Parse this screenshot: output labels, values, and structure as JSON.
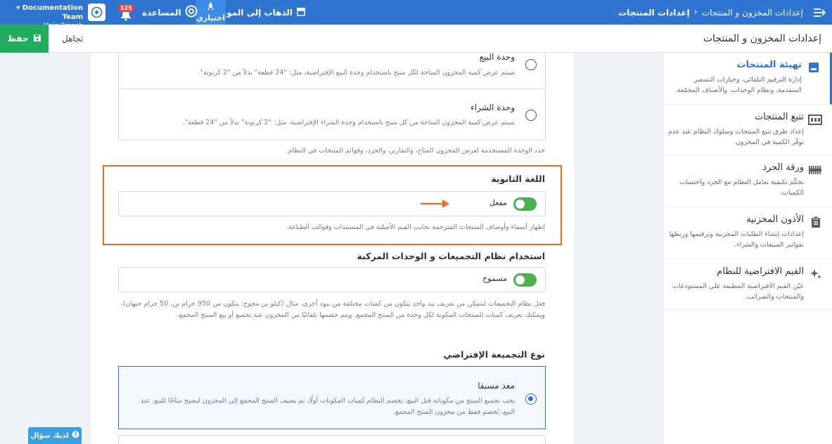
{
  "topbar": {
    "breadcrumbs": [
      "إعدادات المخزون و المنتجات",
      "إعدادات المنتجات"
    ],
    "visit_site": "الذهاب إلى الموقع",
    "beta": "اختياري",
    "help": "المساعدة",
    "notifications_count": "125",
    "org_name": "Documentation Team",
    "branch": "Main Branch"
  },
  "header": {
    "title": "إعدادات المخزون و المنتجات",
    "save": "حفظ",
    "ignore": "تجاهل"
  },
  "sidebar": {
    "items": [
      {
        "title": "تهيئة المنتجات",
        "desc": "إدارة الترقيم التلقائي، وخيارات التسعير المتقدمة، ونظام الوحدات، والأصناف المجمّعة."
      },
      {
        "title": "تتبع المنتجات",
        "desc": "إعداد طرق تتبع المنتجات وسلوك النظام عند عدم توفّر الكمية في المخزون."
      },
      {
        "title": "ورقة الجرد",
        "desc": "تحكّم بكيفية تعامل النظام مع الجرد واحتساب الكميات."
      },
      {
        "title": "الأذون المخزنية",
        "desc": "إعدادات إنشاء الطلبات المخزنية وترقيمها وربطها بفواتير المبيعات والشراء."
      },
      {
        "title": "القيم الافتراضية للنظام",
        "desc": "عيّن القيم الافتراضية المطبقة على المستودعات والمنتجات والضرائب."
      }
    ]
  },
  "main": {
    "unit_options": [
      {
        "title": "وحدة البيع",
        "desc": "سيتم عرض كمية المخزون المتاحة لكل منتج باستخدام وحدة البيع الإفتراضية، مثل: \"24 قطعة\" بدلاً من \"2 كرتونة\"."
      },
      {
        "title": "وحدة الشراء",
        "desc": "سيتم عرض كمية المخزون المتاحة من كل منتج باستخدام وحدة الشراء الإفتراضية، مثل: \"2 كرتونة\" بدلاً من \"24 قطعة\"."
      }
    ],
    "unit_help": "حدد الوحدة المستخدمة لعرض المخزون المتاح، والتقارير، والجرد، وقوائم المنتجات في النظام.",
    "secondary_language": {
      "title": "اللغة الثانوية",
      "toggle_label": "مفعل",
      "help": "إظهار أسماء وأوصاف المنتجات المترجمة بجانب القيم الأصلية في المستندات وقوالب الطباعة."
    },
    "bundles": {
      "title": "استخدام نظام التجميعات و الوحدات المركبة",
      "toggle_label": "مسموح",
      "help": "فعل نظام التجميعات لتتمكن من تعريف بند واحد يتكون من كميات مختلفة من بنود أخرى، مثال (كيلو بن محوج: يتكون من 950 جرام بن، 50 جرام حبهان)، ويمكنك تعريف كميات للمنتجات المكونة لكل وحدة من المنتج المجمع، ويتم خصمها تلقائيًا من المخزون عند تجميع أو بيع المنتج المجمع."
    },
    "default_bundle": {
      "title": "نوع التجميعة الإفتراضي",
      "option_title": "معد مسبقا",
      "option_desc": "يجب تجميع المنتج من مكوناته قبل البيع. يخصم النظام كميات المكونات أولًا، ثم يضيف المنتج المجمع إلى المخزون ليصبح متاحًا للبيع. عند البيع، يُخصم فقط من مخزون المنتج المجمع."
    }
  },
  "ask_button": "لديك سؤال",
  "colors": {
    "primary": "#2f74d0",
    "save": "#21ad5e",
    "highlight": "#f26b1d",
    "toggle_on": "#4caf50"
  }
}
